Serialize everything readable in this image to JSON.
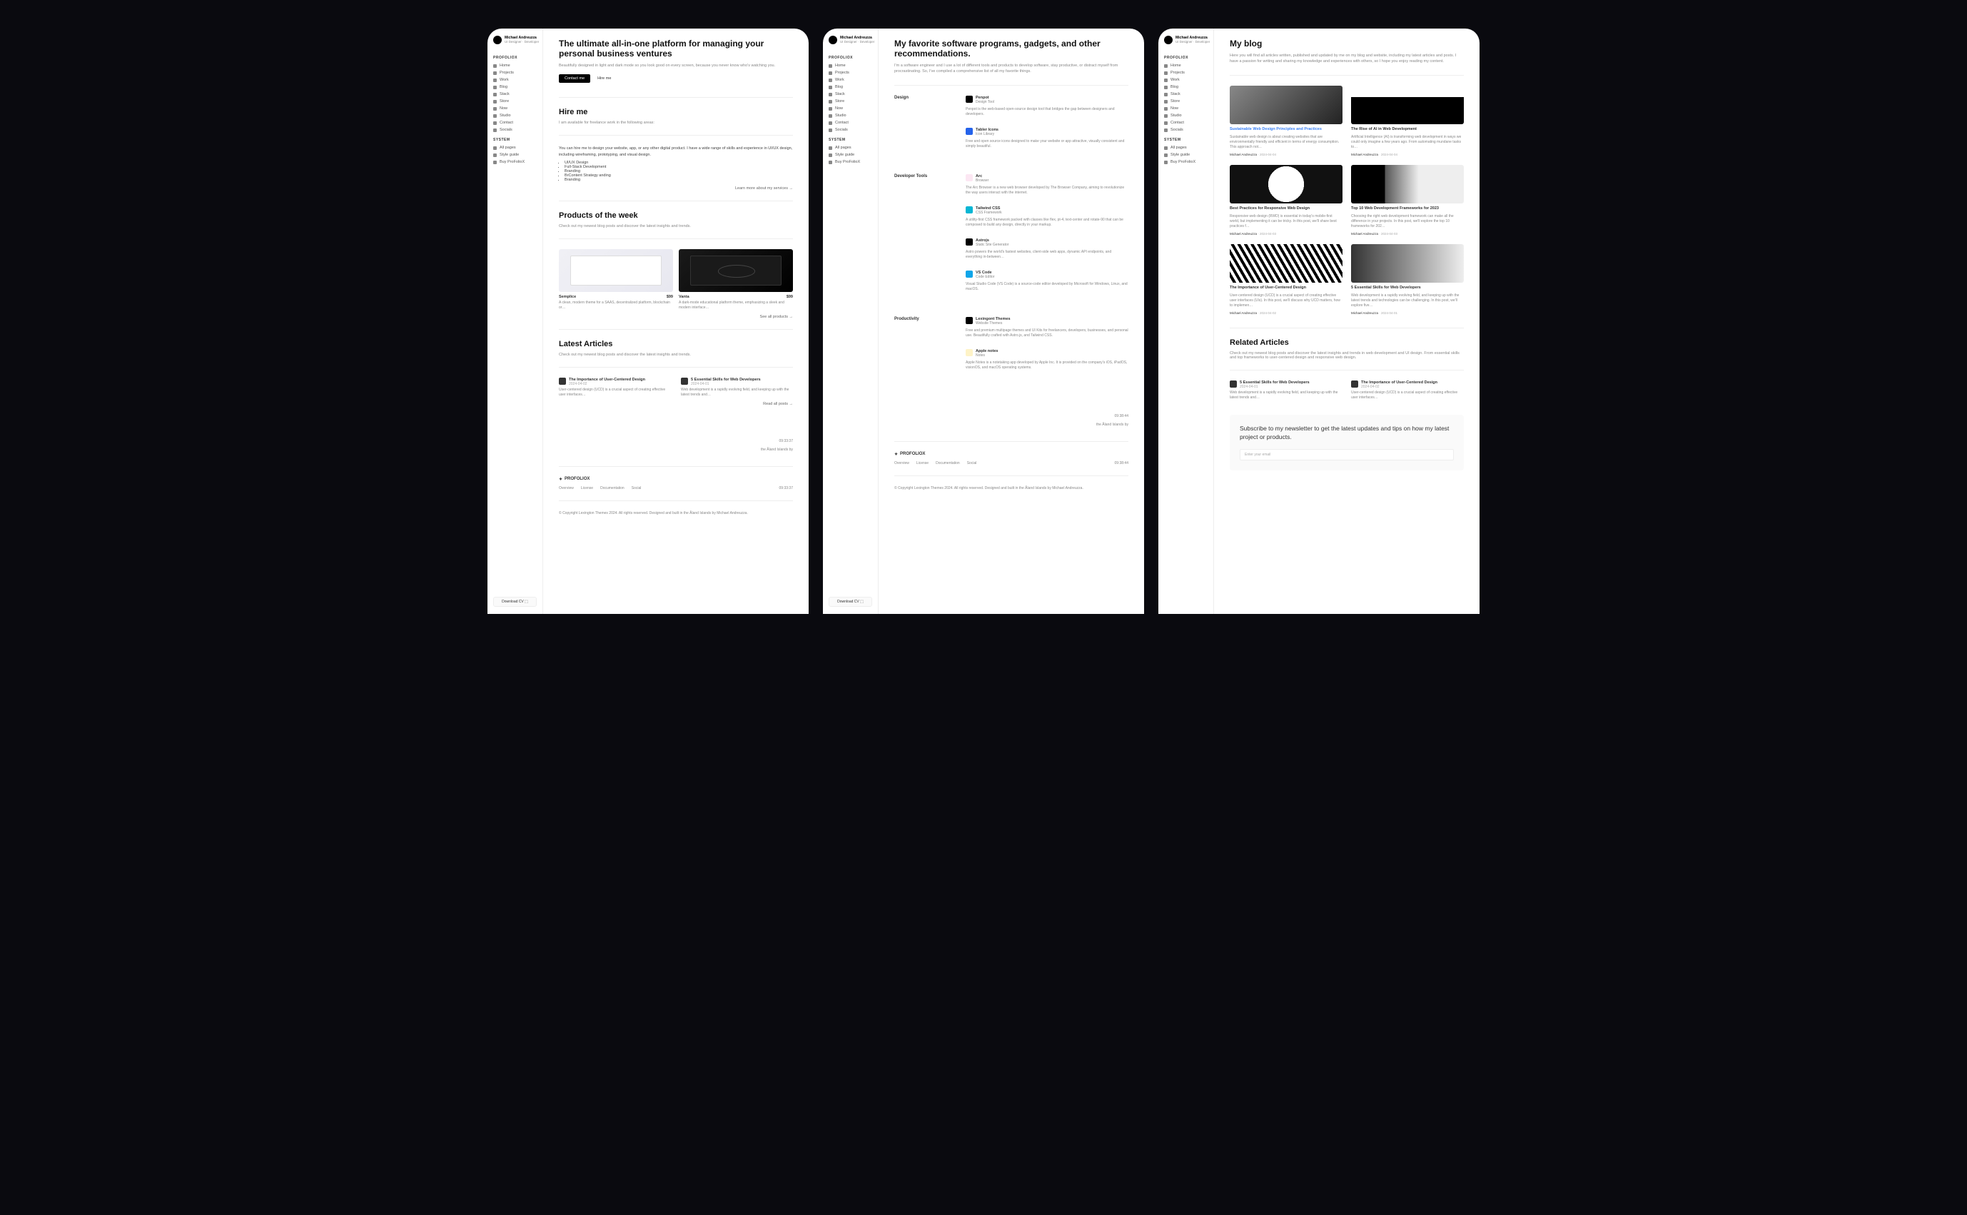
{
  "profile": {
    "name": "Michael Andreuzza",
    "role": "UI Designer · Developer"
  },
  "brand": "PROFOLIOX",
  "nav": [
    {
      "label": "Home"
    },
    {
      "label": "Projects"
    },
    {
      "label": "Work"
    },
    {
      "label": "Blog"
    },
    {
      "label": "Stack"
    },
    {
      "label": "Store"
    },
    {
      "label": "Now"
    },
    {
      "label": "Studio"
    },
    {
      "label": "Contact"
    },
    {
      "label": "Socials"
    }
  ],
  "system_label": "SYSTEM",
  "system": [
    {
      "label": "All pages"
    },
    {
      "label": "Style guide"
    },
    {
      "label": "Buy ProFolioX"
    }
  ],
  "cv": "Download CV",
  "home": {
    "title": "The ultimate all-in-one platform for managing your personal business ventures",
    "desc": "Beautifully designed in light and dark mode so you look good on every screen, because you never know who's watching you.",
    "contact": "Contact me",
    "hire": "Hire me",
    "hire_h": "Hire me",
    "hire_sub": "I am available for freelance work in the following areas:",
    "hire_desc": "You can hire me to design your website, app, or any other digital product. I have a wide range of skills and experience in UI/UX design, including wireframing, prototyping, and visual design.",
    "skills": [
      "UI/UX Design",
      "Full-Stack Development",
      "Branding",
      "BrContent Strategy anding",
      "Branding"
    ],
    "more": "Learn more about my services →",
    "prod_h": "Products of the week",
    "prod_sub": "Check out my newest blog posts and discover the latest insights and trends.",
    "products": [
      {
        "name": "Semplice",
        "price": "$99",
        "desc": "A clean, modern theme for a SAAS, decentralized platform, blockchain or…"
      },
      {
        "name": "Vanta",
        "price": "$99",
        "desc": "A dark-mode educational platform theme, emphasizing a sleek and modern interface…"
      }
    ],
    "all_prod": "See all products →",
    "art_h": "Latest Articles",
    "art_sub": "Check out my newest blog posts and discover the latest insights and trends.",
    "articles": [
      {
        "title": "The Importance of User-Centered Design",
        "date": "2024-04-02",
        "desc": "User-centered design (UCD) is a crucial aspect of creating effective user interfaces…"
      },
      {
        "title": "5 Essential Skills for Web Developers",
        "date": "2024-04-01",
        "desc": "Web development is a rapidly evolving field, and keeping up with the latest trends and…"
      }
    ],
    "all_posts": "Read all posts →"
  },
  "stack": {
    "title": "My favorite software programs, gadgets, and other recommendations.",
    "desc": "I'm a software engineer and I use a lot of different tools and products to develop software, stay productive, or distract myself from procrastinating. So, I've compiled a comprehensive list of all my favorite things.",
    "cats": [
      {
        "name": "Design",
        "items": [
          {
            "name": "Penpot",
            "sub": "Design Tool",
            "color": "#000",
            "desc": "Penpot is the web-based open-source design tool that bridges the gap between designers and developers."
          },
          {
            "name": "Tabler Icons",
            "sub": "Icon Library",
            "color": "#2563eb",
            "desc": "Free and open source icons designed to make your website or app attractive, visually consistent and simply beautiful."
          }
        ]
      },
      {
        "name": "Developer Tools",
        "items": [
          {
            "name": "Arc",
            "sub": "Browser",
            "color": "#fce7f3",
            "desc": "The Arc Browser is a new web browser developed by The Browser Company, aiming to revolutionize the way users interact with the internet."
          },
          {
            "name": "Tailwind CSS",
            "sub": "CSS Framework",
            "color": "#06b6d4",
            "desc": "A utility-first CSS framework packed with classes like flex, pt-4, text-center and rotate-90 that can be composed to build any design, directly in your markup."
          },
          {
            "name": "Astrojs",
            "sub": "Static Site Generator",
            "color": "#000",
            "desc": "Astro powers the world's fastest websites, client-side web apps, dynamic API endpoints, and everything in-between…"
          },
          {
            "name": "VS Code",
            "sub": "Code Editor",
            "color": "#0ea5e9",
            "desc": "Visual Studio Code (VS Code) is a source-code editor developed by Microsoft for Windows, Linux, and macOS."
          }
        ]
      },
      {
        "name": "Productivity",
        "items": [
          {
            "name": "Lexingont Themes",
            "sub": "Website Themes",
            "color": "#000",
            "desc": "Free and premium multipage themes and UI Kits for freelancers, developers, businesses, and personal use. Beautifully crafted with Astro.js, and Tailwind CSS."
          },
          {
            "name": "Apple notes",
            "sub": "Notes",
            "color": "#fef3c7",
            "desc": "Apple Notes is a notetaking app developed by Apple Inc. It is provided on the company's iOS, iPadOS, visionOS, and macOS operating systems."
          }
        ]
      }
    ]
  },
  "blog": {
    "title": "My blog",
    "desc": "Here you will find all articles written, published and updated by me on my blog and website, including my latest articles and posts. I have a passion for writing and sharing my knowledge and experiences with others, so I hope you enjoy reading my content.",
    "posts": [
      {
        "title": "Sustainable Web Design Principles and Practices",
        "hl": true,
        "desc": "Sustainable web design is about creating websites that are environmentally friendly and efficient in terms of energy consumption. This approach not…",
        "author": "Michael Andreuzza",
        "date": "2024-04-04"
      },
      {
        "title": "The Rise of AI in Web Development",
        "desc": "Artificial Intelligence (AI) is transforming web development in ways we could only imagine a few years ago. From automating mundane tasks to…",
        "author": "Michael Andreuzza",
        "date": "2024-04-04"
      },
      {
        "title": "Best Practices for Responsive Web Design",
        "desc": "Responsive web design (RWD) is essential in today's mobile-first world, but implementing it can be tricky. In this post, we'll share best practices f…",
        "author": "Michael Andreuzza",
        "date": "2024-04-03"
      },
      {
        "title": "Top 10 Web Development Frameworks for 2023",
        "desc": "Choosing the right web development framework can make all the difference in your projects. In this post, we'll explore the top 10 frameworks for 202…",
        "author": "Michael Andreuzza",
        "date": "2024-04-03"
      },
      {
        "title": "The Importance of User-Centered Design",
        "desc": "User-centered design (UCD) is a crucial aspect of creating effective user interfaces (UIs). In this post, we'll discuss why UCD matters, how to implemen…",
        "author": "Michael Andreuzza",
        "date": "2024-04-02"
      },
      {
        "title": "5 Essential Skills for Web Developers",
        "desc": "Web development is a rapidly evolving field, and keeping up with the latest trends and technologies can be challenging. In this post, we'll explore five…",
        "author": "Michael Andreuzza",
        "date": "2024-04-01"
      }
    ],
    "related_h": "Related Articles",
    "related_sub": "Check out my newest blog posts and discover the latest insights and trends in web development and UI design. From essential skills and top frameworks to user-centered design and responsive web design.",
    "related": [
      {
        "title": "5 Essential Skills for Web Developers",
        "date": "2024-04-01",
        "desc": "Web development is a rapidly evolving field, and keeping up with the latest trends and…"
      },
      {
        "title": "The Importance of User-Centered Design",
        "date": "2024-04-02",
        "desc": "User-centered design (UCD) is a crucial aspect of creating effective user interfaces…"
      }
    ],
    "newsletter_h": "Subscribe to my newsletter to get the latest updates and tips on how my latest project or products.",
    "newsletter_ph": "Enter your email"
  },
  "footer": {
    "brand": "PROFOLIOX",
    "links": [
      "Overview",
      "License",
      "Documentation",
      "Social"
    ],
    "time1": "09:38:44",
    "time2": "09:33:37",
    "loc": "the Åland Islands by",
    "copy": "© Copyright Lexington Themes 2024. All rights reserved. Designed and built in the Åland Islands by Michael Andreuzza."
  }
}
